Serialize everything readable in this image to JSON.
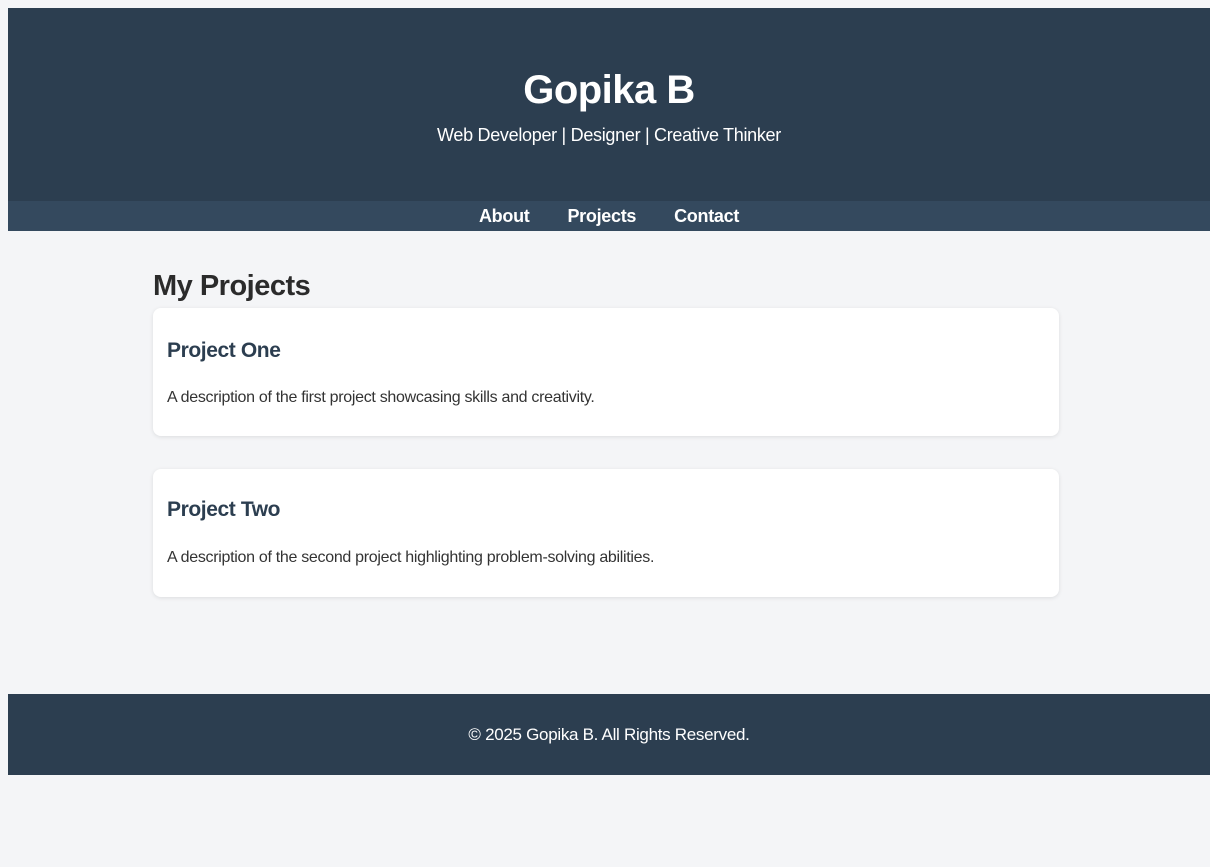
{
  "header": {
    "title": "Gopika B",
    "tagline": "Web Developer | Designer | Creative Thinker"
  },
  "nav": {
    "items": [
      {
        "label": "About"
      },
      {
        "label": "Projects"
      },
      {
        "label": "Contact"
      }
    ]
  },
  "main": {
    "section_title": "My Projects",
    "projects": [
      {
        "title": "Project One",
        "description": "A description of the first project showcasing skills and creativity."
      },
      {
        "title": "Project Two",
        "description": "A description of the second project highlighting problem-solving abilities."
      }
    ]
  },
  "footer": {
    "text": "© 2025 Gopika B. All Rights Reserved."
  },
  "colors": {
    "header_bg": "#2c3e50",
    "nav_bg": "#34495e",
    "page_bg": "#f4f5f7",
    "card_bg": "#ffffff",
    "project_title": "#2c3e50"
  }
}
